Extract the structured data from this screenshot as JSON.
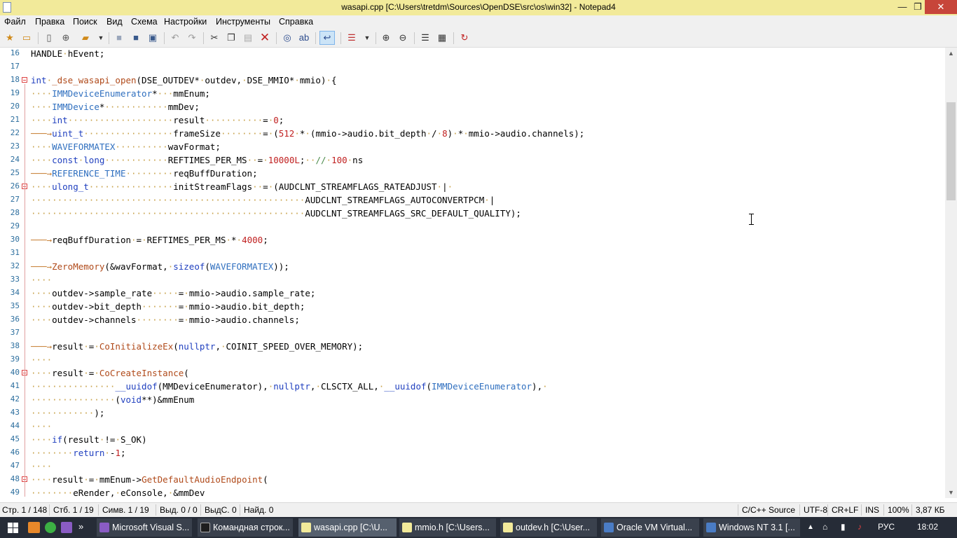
{
  "window": {
    "title": "wasapi.cpp [C:\\Users\\tretdm\\Sources\\OpenDSE\\src\\os\\win32] - Notepad4",
    "controls": {
      "minimize": "—",
      "maximize": "❐",
      "close": "✕"
    }
  },
  "menu": [
    "Файл",
    "Правка",
    "Поиск",
    "Вид",
    "Схема",
    "Настройки",
    "Инструменты",
    "Справка"
  ],
  "toolbar": {
    "icons": [
      "new-favorite-icon",
      "open-folder-icon",
      "new-file-icon",
      "new-window-icon",
      "open-icon",
      "dropdown-icon",
      "save-icon",
      "save-as-icon",
      "save-all-icon",
      "undo-icon",
      "redo-icon",
      "cut-icon",
      "copy-icon",
      "paste-icon",
      "delete-icon",
      "find-icon",
      "replace-icon",
      "word-wrap-icon",
      "view-icon",
      "dropdown-icon",
      "zoom-in-icon",
      "zoom-out-icon",
      "schema-icon",
      "settings-icon",
      "exit-icon"
    ]
  },
  "editor": {
    "lines": [
      {
        "n": "16",
        "text": "HANDLE·hEvent;"
      },
      {
        "n": "17",
        "text": ""
      },
      {
        "n": "18",
        "text": "int·_dse_wasapi_open(DSE_OUTDEV*·outdev,·DSE_MMIO*·mmio)·{"
      },
      {
        "n": "19",
        "text": "····IMMDeviceEnumerator*···mmEnum;"
      },
      {
        "n": "20",
        "text": "····IMMDevice*············mmDev;"
      },
      {
        "n": "21",
        "text": "····int····················result···········=·0;"
      },
      {
        "n": "22",
        "text": "───→uint_t·················frameSize········=·(512·*·(mmio->audio.bit_depth·/·8)·*·mmio->audio.channels);"
      },
      {
        "n": "23",
        "text": "····WAVEFORMATEX··········wavFormat;"
      },
      {
        "n": "24",
        "text": "····const·long············REFTIMES_PER_MS··=·10000L;··//·100·ns"
      },
      {
        "n": "25",
        "text": "───→REFERENCE_TIME·········reqBuffDuration;"
      },
      {
        "n": "26",
        "text": "····ulong_t················initStreamFlags··=·(AUDCLNT_STREAMFLAGS_RATEADJUST·|·"
      },
      {
        "n": "27",
        "text": "····················································AUDCLNT_STREAMFLAGS_AUTOCONVERTPCM·|"
      },
      {
        "n": "28",
        "text": "····················································AUDCLNT_STREAMFLAGS_SRC_DEFAULT_QUALITY);"
      },
      {
        "n": "29",
        "text": ""
      },
      {
        "n": "30",
        "text": "───→reqBuffDuration·=·REFTIMES_PER_MS·*·4000;"
      },
      {
        "n": "31",
        "text": ""
      },
      {
        "n": "32",
        "text": "───→ZeroMemory(&wavFormat,·sizeof(WAVEFORMATEX));"
      },
      {
        "n": "33",
        "text": "····"
      },
      {
        "n": "34",
        "text": "····outdev->sample_rate·····=·mmio->audio.sample_rate;"
      },
      {
        "n": "35",
        "text": "····outdev->bit_depth·······=·mmio->audio.bit_depth;"
      },
      {
        "n": "36",
        "text": "····outdev->channels········=·mmio->audio.channels;"
      },
      {
        "n": "37",
        "text": ""
      },
      {
        "n": "38",
        "text": "───→result·=·CoInitializeEx(nullptr,·COINIT_SPEED_OVER_MEMORY);"
      },
      {
        "n": "39",
        "text": "····"
      },
      {
        "n": "40",
        "text": "····result·=·CoCreateInstance("
      },
      {
        "n": "41",
        "text": "················__uuidof(MMDeviceEnumerator),·nullptr,·CLSCTX_ALL,·__uuidof(IMMDeviceEnumerator),·"
      },
      {
        "n": "42",
        "text": "················(void**)&mmEnum"
      },
      {
        "n": "43",
        "text": "············);"
      },
      {
        "n": "44",
        "text": "····"
      },
      {
        "n": "45",
        "text": "····if(result·!=·S_OK)"
      },
      {
        "n": "46",
        "text": "········return·-1;"
      },
      {
        "n": "47",
        "text": "····"
      },
      {
        "n": "48",
        "text": "····result·=·mmEnum->GetDefaultAudioEndpoint("
      },
      {
        "n": "49",
        "text": "········eRender,·eConsole,·&mmDev"
      }
    ]
  },
  "status": {
    "line": "Стр. 1 / 148",
    "col": "Стб. 1 / 19",
    "char": "Симв. 1 / 19",
    "sel": "Выд. 0 / 0",
    "selc": "ВыдС. 0",
    "found": "Найд. 0",
    "lang": "C/C++ Source",
    "encoding": "UTF-8",
    "eol": "CR+LF",
    "ins": "INS",
    "zoom": "100%",
    "size": "3,87 КБ"
  },
  "taskbar": {
    "items": [
      {
        "label": "Microsoft Visual S...",
        "color": "#8a5cc4"
      },
      {
        "label": "Командная строк...",
        "color": "#1e1e1e"
      },
      {
        "label": "wasapi.cpp [C:\\U...",
        "color": "#f2ea9a"
      },
      {
        "label": "mmio.h [C:\\Users...",
        "color": "#f2ea9a"
      },
      {
        "label": "outdev.h [C:\\User...",
        "color": "#f2ea9a"
      },
      {
        "label": "Oracle VM Virtual...",
        "color": "#4a7cc4"
      },
      {
        "label": "Windows NT 3.1 [...",
        "color": "#4a7cc4"
      }
    ],
    "lang": "РУС",
    "clock": "18:02"
  }
}
